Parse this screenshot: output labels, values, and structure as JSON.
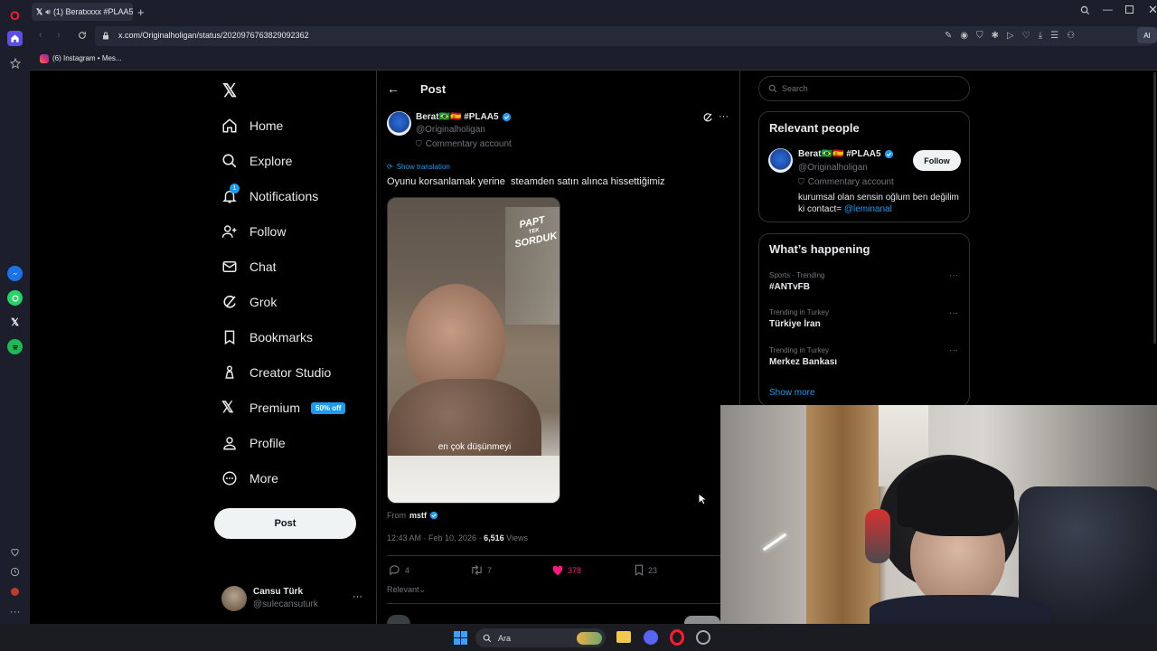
{
  "browser": {
    "tab_title": "(1) Beratxxxx #PLAA5",
    "url": "x.com/Originalholigan/status/2020976763829092362",
    "bookmark": "(6) Instagram • Mes...",
    "extension_label": "AI"
  },
  "nav": {
    "items": [
      {
        "label": "Home"
      },
      {
        "label": "Explore"
      },
      {
        "label": "Notifications",
        "badge": "1"
      },
      {
        "label": "Follow"
      },
      {
        "label": "Chat"
      },
      {
        "label": "Grok"
      },
      {
        "label": "Bookmarks"
      },
      {
        "label": "Creator Studio"
      },
      {
        "label": "Premium",
        "badge": "50% off"
      },
      {
        "label": "Profile"
      },
      {
        "label": "More"
      }
    ],
    "post_button": "Post",
    "account": {
      "name": "Cansu Türk",
      "handle": "@sulecansuturk",
      "more": "···"
    }
  },
  "post": {
    "header": "Post",
    "author": {
      "name": "Berat🇧🇷🇪🇸 #PLAA5",
      "handle": "@Originalholigan",
      "label": "Commentary account"
    },
    "show_translation": "Show translation",
    "text": "Oyunu korsanlamak yerine  steamden satın alınca hissettiğimiz",
    "video": {
      "caption": "en çok düşünmeyi",
      "watermark_top": "PAPT",
      "watermark_bottom": "SORDUK",
      "watermark_small": "TEK"
    },
    "from_label": "From",
    "from_user": "mstf",
    "timestamp": "12:43 AM · Feb 10, 2026 · ",
    "views_count": "6,516",
    "views_label": " Views",
    "stats": {
      "replies": "4",
      "reposts": "7",
      "likes": "378",
      "bookmarks": "23"
    },
    "relevant": "Relevant"
  },
  "search": {
    "placeholder": "Search"
  },
  "relevant_people": {
    "title": "Relevant people",
    "name": "Berat🇧🇷🇪🇸 #PLAA5",
    "handle": "@Originalholigan",
    "label": "Commentary account",
    "follow": "Follow",
    "bio_1": "kurumsal olan sensin oğlum ben değilim",
    "bio_2": "ki contact= ",
    "bio_link": "@leminanal"
  },
  "happening": {
    "title": "What’s happening",
    "trends": [
      {
        "meta": "Sports · Trending",
        "name": "#ANTvFB"
      },
      {
        "meta": "Trending in Turkey",
        "name": "Türkiye İran"
      },
      {
        "meta": "Trending in Turkey",
        "name": "Merkez Bankası"
      }
    ],
    "show_more": "Show more"
  },
  "taskbar": {
    "search": "Ara"
  },
  "colors": {
    "accent": "#1d9bf0",
    "like": "#f91880",
    "badge": "#1d9bf0"
  }
}
